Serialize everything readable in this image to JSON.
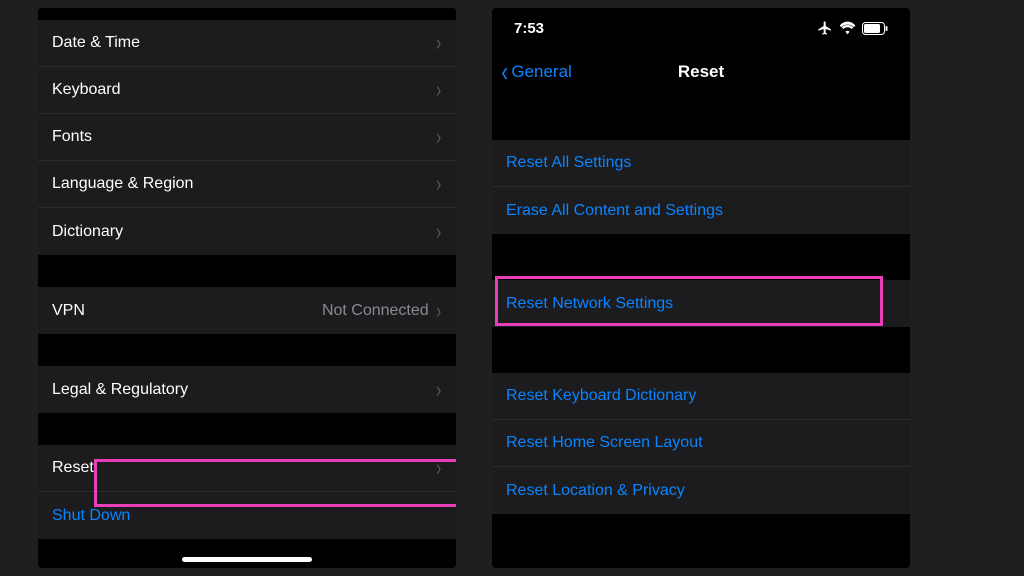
{
  "left": {
    "group1": [
      {
        "label": "Date & Time"
      },
      {
        "label": "Keyboard"
      },
      {
        "label": "Fonts"
      },
      {
        "label": "Language & Region"
      },
      {
        "label": "Dictionary"
      }
    ],
    "vpn": {
      "label": "VPN",
      "value": "Not Connected"
    },
    "legal": {
      "label": "Legal & Regulatory"
    },
    "reset": {
      "label": "Reset"
    },
    "shutdown": {
      "label": "Shut Down"
    }
  },
  "right": {
    "time": "7:53",
    "back": "General",
    "title": "Reset",
    "group1": [
      "Reset All Settings",
      "Erase All Content and Settings"
    ],
    "network": "Reset Network Settings",
    "group3": [
      "Reset Keyboard Dictionary",
      "Reset Home Screen Layout",
      "Reset Location & Privacy"
    ]
  },
  "colors": {
    "accent": "#0a84ff",
    "highlight": "#e83fb8"
  }
}
